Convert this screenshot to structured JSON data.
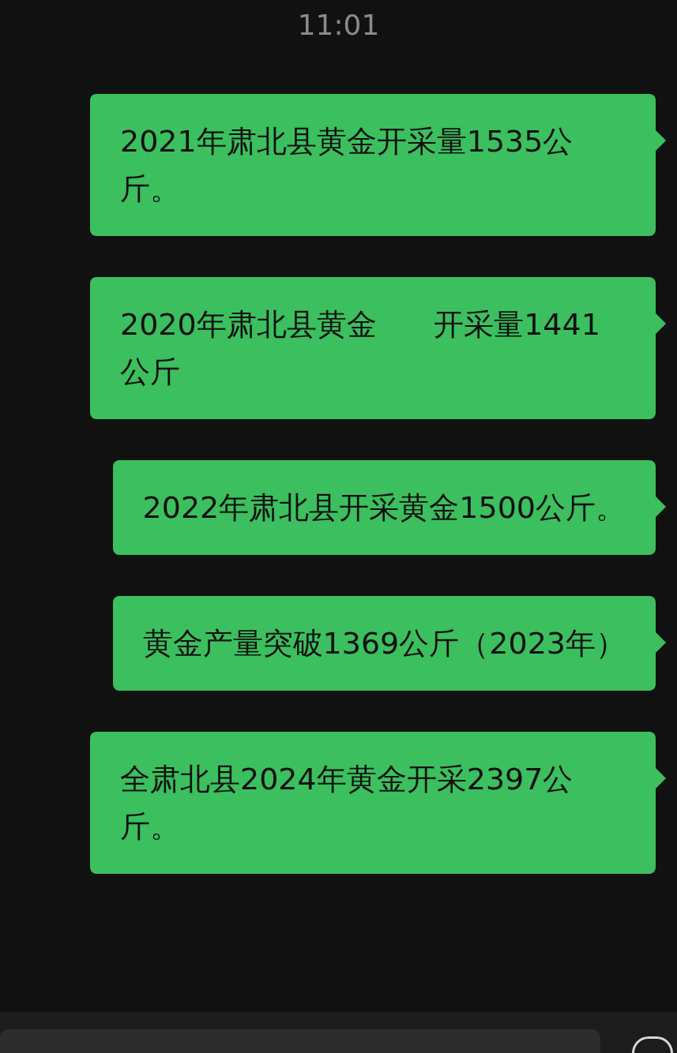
{
  "time": "11:01",
  "messages": [
    {
      "text": "2021年肃北县黄金开采量1535公斤。"
    },
    {
      "text": "2020年肃北县黄金      开采量1441公斤"
    },
    {
      "text": "2022年肃北县开采黄金1500公斤。"
    },
    {
      "text": "黄金产量突破1369公斤（2023年）"
    },
    {
      "text": "全肃北县2024年黄金开采2397公斤。"
    }
  ]
}
